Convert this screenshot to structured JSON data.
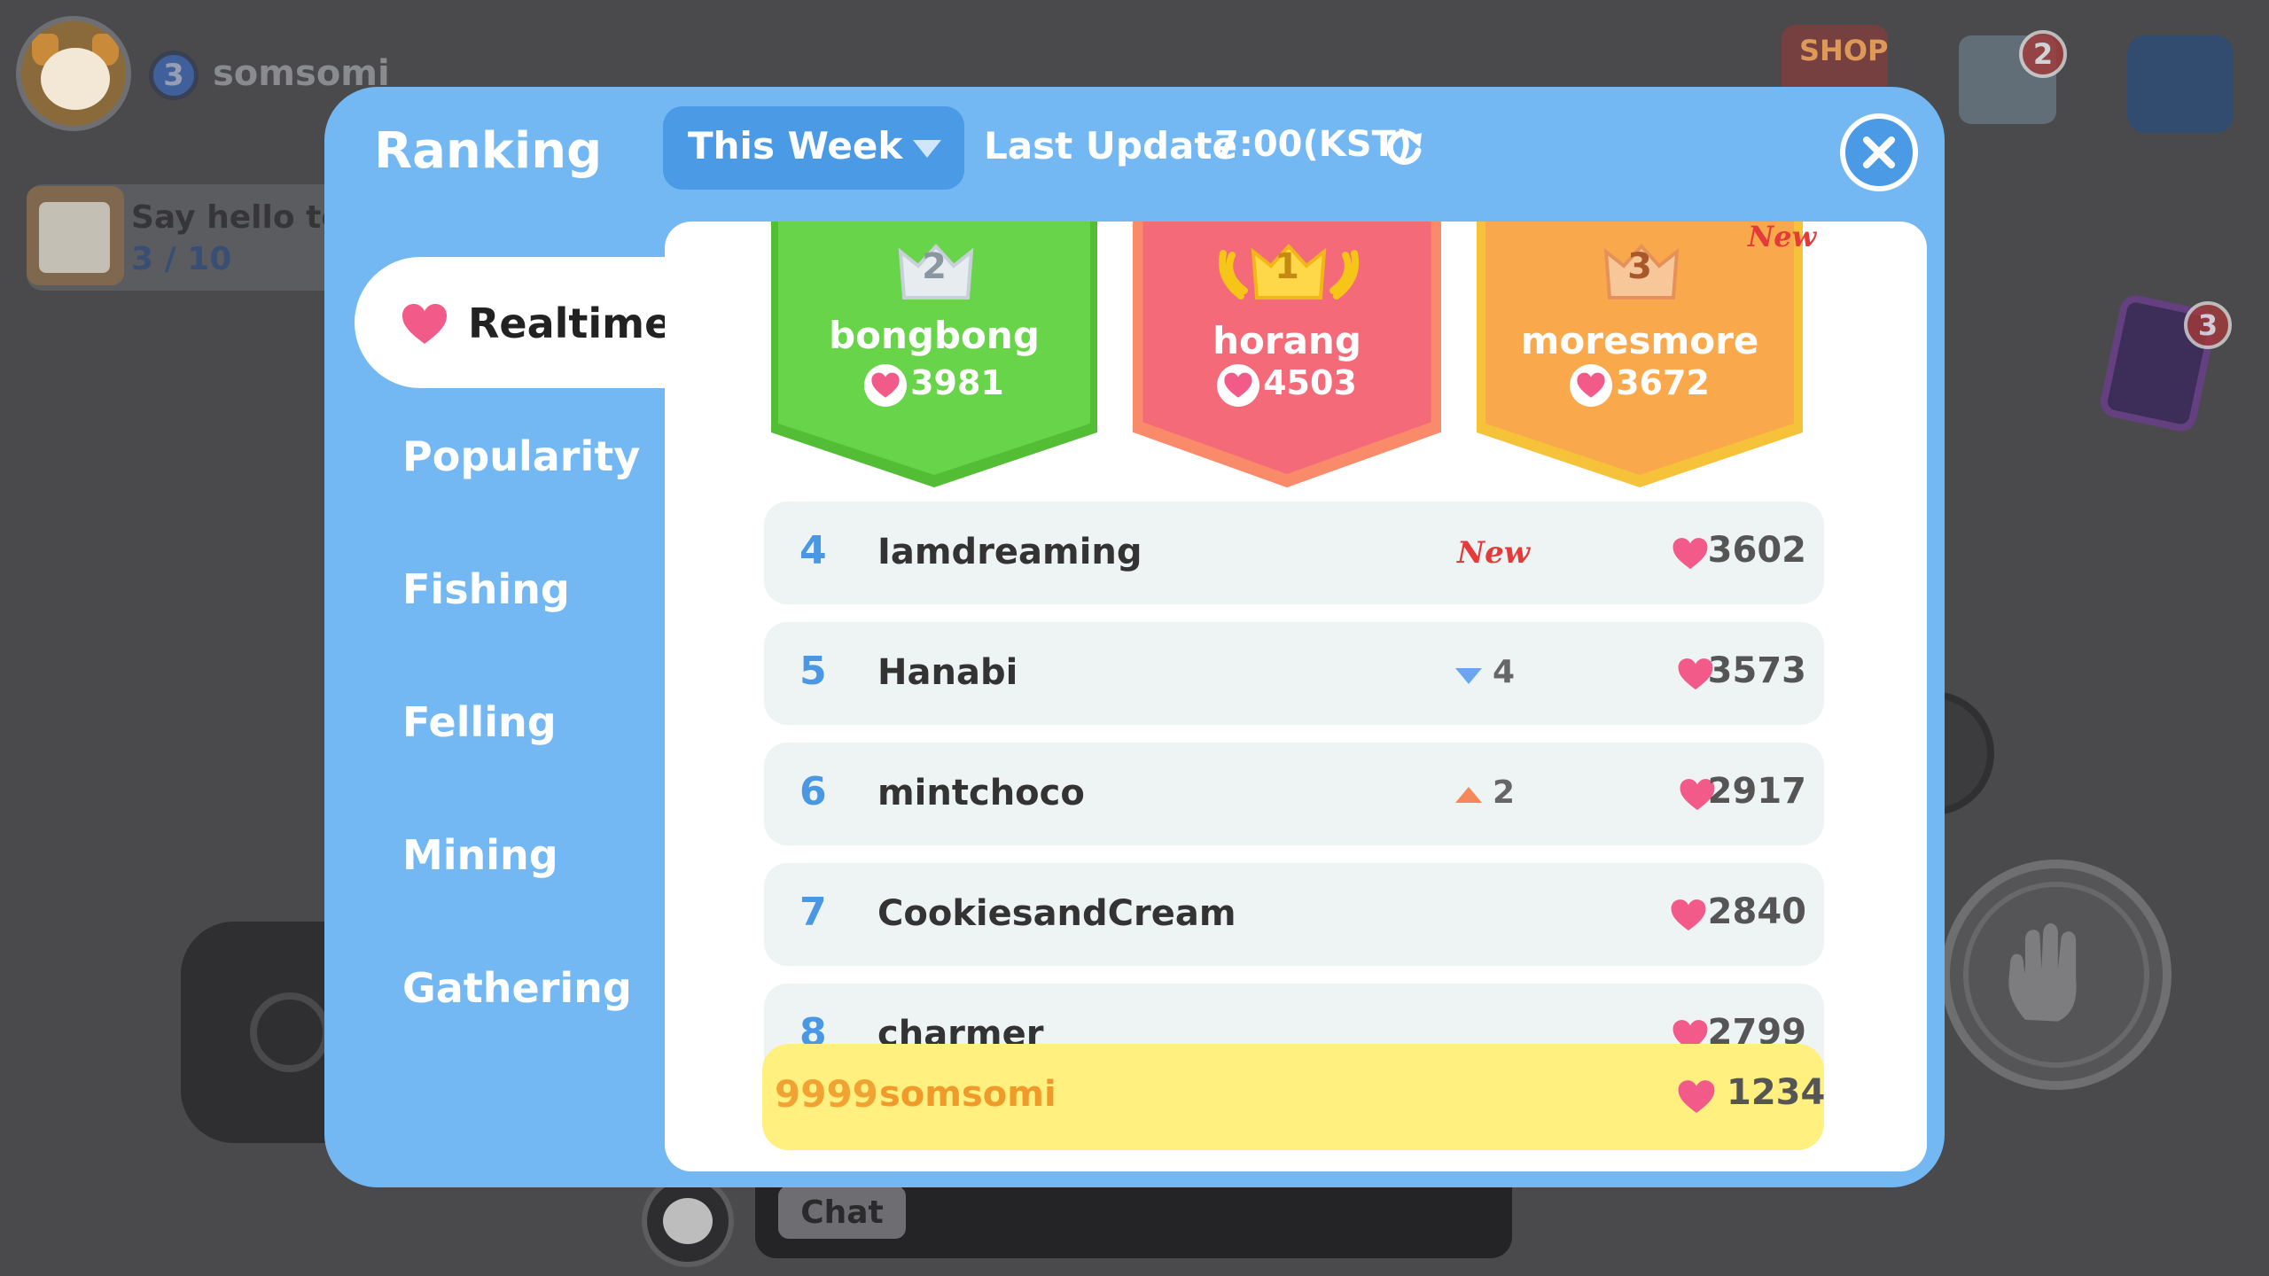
{
  "hud": {
    "player_level": "3",
    "player_name": "somsomi",
    "quest_title": "Say hello to a",
    "quest_progress": "3 / 10",
    "shop_label": "SHOP",
    "mail_badge": "2",
    "card_badge": "3",
    "chat_button": "Chat"
  },
  "modal": {
    "title": "Ranking",
    "period_selected": "This Week",
    "last_update_label": "Last Update",
    "last_update_time": "7:00(KST)"
  },
  "tabs": [
    {
      "label": "Realtime",
      "active": true
    },
    {
      "label": "Popularity",
      "active": false
    },
    {
      "label": "Fishing",
      "active": false
    },
    {
      "label": "Felling",
      "active": false
    },
    {
      "label": "Mining",
      "active": false
    },
    {
      "label": "Gathering",
      "active": false
    }
  ],
  "podium": [
    {
      "rank": "2",
      "name": "bongbong",
      "score": "3981",
      "color": "#67d449"
    },
    {
      "rank": "1",
      "name": "horang",
      "score": "4503",
      "color": "#f46a78"
    },
    {
      "rank": "3",
      "name": "moresmore",
      "score": "3672",
      "color": "#f9a94b",
      "new_tag": "New"
    }
  ],
  "rows": [
    {
      "rank": "4",
      "name": "Iamdreaming",
      "change": "New",
      "change_type": "new",
      "score": "3602"
    },
    {
      "rank": "5",
      "name": "Hanabi",
      "change": "4",
      "change_type": "down",
      "score": "3573"
    },
    {
      "rank": "6",
      "name": "mintchoco",
      "change": "2",
      "change_type": "up",
      "score": "2917"
    },
    {
      "rank": "7",
      "name": "CookiesandCream",
      "change": "",
      "change_type": "none",
      "score": "2840"
    },
    {
      "rank": "8",
      "name": "charmer",
      "change": "",
      "change_type": "none",
      "score": "2799"
    }
  ],
  "my_rank": {
    "rank": "9999",
    "name": "somsomi",
    "score": "1234"
  },
  "colors": {
    "accent": "#73b8f2",
    "heart": "#f25a8a",
    "rank_blue": "#4a97e3"
  }
}
